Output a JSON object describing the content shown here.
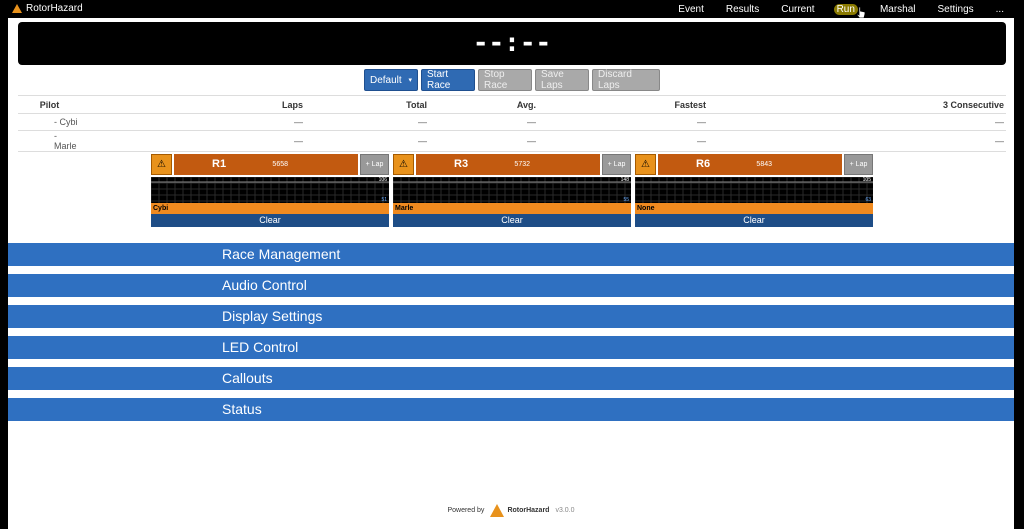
{
  "nav": {
    "brand": "RotorHazard",
    "items": [
      "Event",
      "Results",
      "Current",
      "Run",
      "Marshal",
      "Settings",
      "..."
    ]
  },
  "clock": "--:--",
  "controls": {
    "profile": "Default",
    "start": "Start Race",
    "stop": "Stop Race",
    "save": "Save Laps",
    "discard": "Discard Laps"
  },
  "leaderboard": {
    "headers": [
      "Pilot",
      "Laps",
      "Total",
      "Avg.",
      "Fastest",
      "3 Consecutive"
    ],
    "rows": [
      {
        "pilot": "- Cybi",
        "laps": "—",
        "total": "—",
        "avg": "—",
        "fastest": "—",
        "consec": "—"
      },
      {
        "pilot": "- Marle",
        "laps": "—",
        "total": "—",
        "avg": "—",
        "fastest": "—",
        "consec": "—"
      }
    ]
  },
  "nodes": [
    {
      "name": "R1",
      "freq": "5658",
      "pilot": "Cybi",
      "rssi_top": "106",
      "rssi_low": "51"
    },
    {
      "name": "R3",
      "freq": "5732",
      "pilot": "Marle",
      "rssi_top": "148",
      "rssi_low": "55"
    },
    {
      "name": "R6",
      "freq": "5843",
      "pilot": "None",
      "rssi_top": "105",
      "rssi_low": "63"
    }
  ],
  "node_labels": {
    "lap": "+ Lap",
    "clear": "Clear",
    "warn": "⚠"
  },
  "panels": [
    "Race Management",
    "Audio Control",
    "Display Settings",
    "LED Control",
    "Callouts",
    "Status"
  ],
  "footer": {
    "powered": "Powered by",
    "logo": "RotorHazard",
    "version": "v3.0.0"
  },
  "colors": {
    "accent": "#2f70c1",
    "node": "#c25a10",
    "pilot_bar": "#f08a1f",
    "clear": "#1e4d86"
  }
}
